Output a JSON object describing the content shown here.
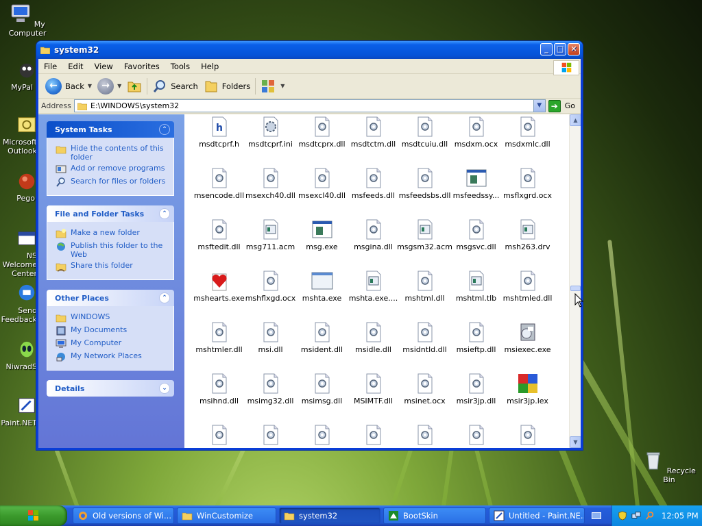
{
  "desktop": {
    "icons": [
      {
        "label": "My Computer",
        "icon": "my-computer-icon"
      },
      {
        "label": "MyPal",
        "icon": "mypal-icon"
      },
      {
        "label": "Microsoft Outlook",
        "icon": "outlook-icon"
      },
      {
        "label": "Pegol",
        "icon": "pegol-icon"
      },
      {
        "label": "NS Welcome Center",
        "icon": "ns-welcome-icon"
      },
      {
        "label": "Send Feedback",
        "icon": "send-feedback-icon"
      },
      {
        "label": "NiwradS",
        "icon": "niwradsoft-icon"
      },
      {
        "label": "Paint.NET",
        "icon": "paint-net-icon"
      }
    ],
    "recycle_bin": "Recycle Bin"
  },
  "window": {
    "title": "system32",
    "menu": [
      "File",
      "Edit",
      "View",
      "Favorites",
      "Tools",
      "Help"
    ],
    "toolbar": {
      "back": "Back",
      "search": "Search",
      "folders": "Folders"
    },
    "address": {
      "label": "Address",
      "value": "E:\\WINDOWS\\system32",
      "go": "Go"
    },
    "tasks": {
      "system": {
        "title": "System Tasks",
        "items": [
          "Hide the contents of this folder",
          "Add or remove programs",
          "Search for files or folders"
        ]
      },
      "file_folder": {
        "title": "File and Folder Tasks",
        "items": [
          "Make a new folder",
          "Publish this folder to the Web",
          "Share this folder"
        ]
      },
      "other": {
        "title": "Other Places",
        "items": [
          "WINDOWS",
          "My Documents",
          "My Computer",
          "My Network Places"
        ]
      },
      "details": {
        "title": "Details"
      }
    },
    "files": [
      {
        "name": "msdtcprf.h",
        "type": "header"
      },
      {
        "name": "msdtcprf.ini",
        "type": "ini"
      },
      {
        "name": "msdtcprx.dll",
        "type": "dll"
      },
      {
        "name": "msdtctm.dll",
        "type": "dll"
      },
      {
        "name": "msdtcuiu.dll",
        "type": "dll"
      },
      {
        "name": "msdxm.ocx",
        "type": "dll"
      },
      {
        "name": "msdxmlc.dll",
        "type": "dll"
      },
      {
        "name": "msencode.dll",
        "type": "dll"
      },
      {
        "name": "msexch40.dll",
        "type": "dll"
      },
      {
        "name": "msexcl40.dll",
        "type": "dll"
      },
      {
        "name": "msfeeds.dll",
        "type": "dll"
      },
      {
        "name": "msfeedsbs.dll",
        "type": "dll"
      },
      {
        "name": "msfeedssy...",
        "type": "exe"
      },
      {
        "name": "msflxgrd.ocx",
        "type": "dll"
      },
      {
        "name": "msftedit.dll",
        "type": "dll"
      },
      {
        "name": "msg711.acm",
        "type": "sys"
      },
      {
        "name": "msg.exe",
        "type": "exe"
      },
      {
        "name": "msgina.dll",
        "type": "dll"
      },
      {
        "name": "msgsm32.acm",
        "type": "sys"
      },
      {
        "name": "msgsvc.dll",
        "type": "dll"
      },
      {
        "name": "msh263.drv",
        "type": "sys"
      },
      {
        "name": "mshearts.exe",
        "type": "hearts"
      },
      {
        "name": "mshflxgd.ocx",
        "type": "dll"
      },
      {
        "name": "mshta.exe",
        "type": "window"
      },
      {
        "name": "mshta.exe....",
        "type": "sys"
      },
      {
        "name": "mshtml.dll",
        "type": "dll"
      },
      {
        "name": "mshtml.tlb",
        "type": "sys"
      },
      {
        "name": "mshtmled.dll",
        "type": "dll"
      },
      {
        "name": "mshtmler.dll",
        "type": "dll"
      },
      {
        "name": "msi.dll",
        "type": "dll"
      },
      {
        "name": "msident.dll",
        "type": "dll"
      },
      {
        "name": "msidle.dll",
        "type": "dll"
      },
      {
        "name": "msidntld.dll",
        "type": "dll"
      },
      {
        "name": "msieftp.dll",
        "type": "dll"
      },
      {
        "name": "msiexec.exe",
        "type": "installer"
      },
      {
        "name": "msihnd.dll",
        "type": "dll"
      },
      {
        "name": "msimg32.dll",
        "type": "dll"
      },
      {
        "name": "msimsg.dll",
        "type": "dll"
      },
      {
        "name": "MSIMTF.dll",
        "type": "dll"
      },
      {
        "name": "msinet.ocx",
        "type": "dll"
      },
      {
        "name": "msir3jp.dll",
        "type": "dll"
      },
      {
        "name": "msir3jp.lex",
        "type": "puzzle"
      },
      {
        "name": "",
        "type": "dll"
      },
      {
        "name": "",
        "type": "dll"
      },
      {
        "name": "",
        "type": "dll"
      },
      {
        "name": "",
        "type": "dll"
      },
      {
        "name": "",
        "type": "dll"
      },
      {
        "name": "",
        "type": "dll"
      },
      {
        "name": "",
        "type": "dll"
      }
    ]
  },
  "taskbar": {
    "items": [
      {
        "label": "Old versions of Wi...",
        "icon": "browser-icon",
        "active": false
      },
      {
        "label": "WinCustomize",
        "icon": "folder-icon",
        "active": false
      },
      {
        "label": "system32",
        "icon": "folder-icon",
        "active": true
      },
      {
        "label": "BootSkin",
        "icon": "bootskin-icon",
        "active": false
      },
      {
        "label": "Untitled - Paint.NE...",
        "icon": "paint-icon",
        "active": false
      }
    ],
    "clock": "12:05 PM"
  },
  "colors": {
    "xp_blue": "#0a5fe8",
    "task_link": "#215dc6",
    "start_green": "#3b9a2c"
  }
}
